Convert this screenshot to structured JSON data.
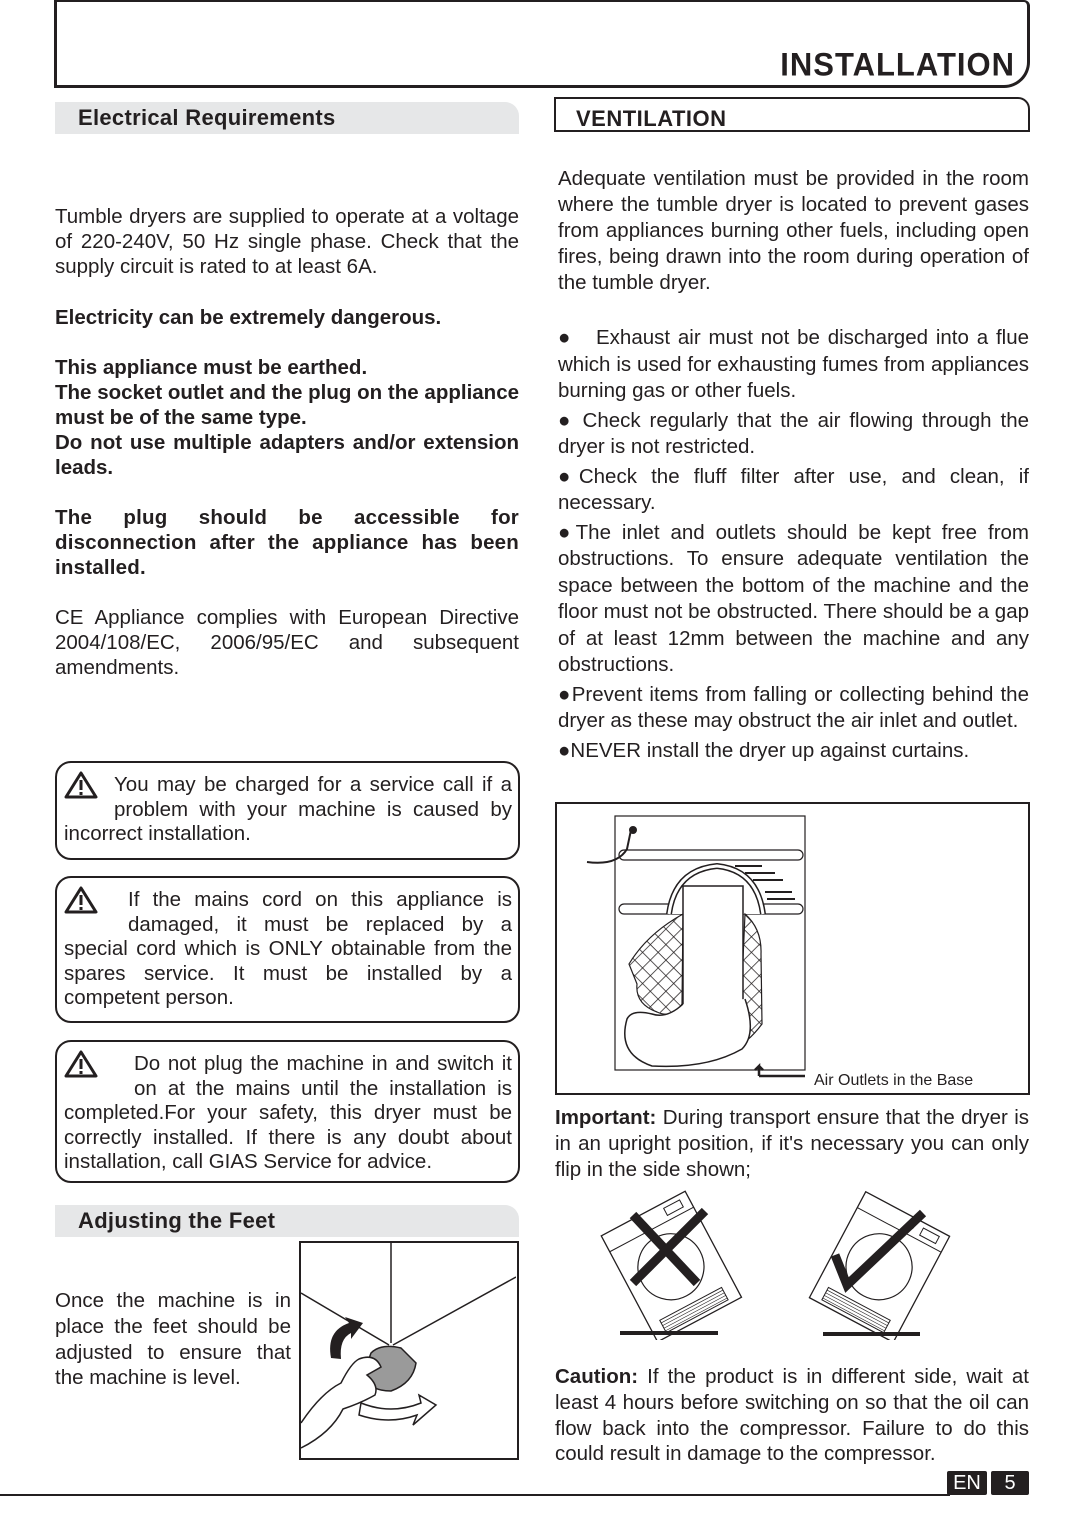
{
  "header": {
    "title": "INSTALLATION"
  },
  "left": {
    "electrical": {
      "heading": "Electrical Requirements",
      "para1": "Tumble dryers are supplied to operate at a voltage of 220-240V, 50 Hz single phase. Check that the supply circuit is rated to at least 6A.",
      "danger": "Electricity can be extremely dangerous.",
      "earthed": "This appliance must be earthed.",
      "socket": "The socket outlet and the plug on the appliance must be of the same type.",
      "adapters": "Do not use multiple adapters and/or extension leads.",
      "accessible": "The plug should be accessible for disconnection after the appliance has been installed.",
      "ce": "CE Appliance complies with European Directive 2004/108/EC, 2006/95/EC and subsequent amendments."
    },
    "warnings": [
      {
        "icon": "warning-triangle-icon",
        "text": "You may be charged for a service call if a problem with your machine is caused by incorrect installation."
      },
      {
        "icon": "warning-triangle-icon",
        "text": "If the mains cord on this appliance is damaged, it must be replaced by a special cord which is ONLY obtainable from the spares service. It must be installed by a competent person."
      },
      {
        "icon": "warning-triangle-icon",
        "text": "Do not plug the machine in and switch it on at the mains until the installation is completed.For your safety, this dryer must be correctly installed. If there is any doubt about installation, call GIAS Service for advice."
      }
    ],
    "feet": {
      "heading": "Adjusting the Feet",
      "text": "Once the machine is in place the feet should be adjusted to ensure that the machine is level."
    }
  },
  "right": {
    "ventilation": {
      "heading": "VENTILATION",
      "intro": "Adequate ventilation must be provided in the room where the tumble dryer is located to prevent gases from appliances burning other fuels, including open fires, being drawn into the room during operation of the tumble dryer.",
      "bullets": [
        "Exhaust air must not be discharged into a flue which is used for exhausting fumes from appliances burning gas or other fuels.",
        "Check regularly that the air flowing through the dryer is not restricted.",
        "Check the fluff filter after use, and clean, if necessary.",
        "The inlet and outlets should be kept free from obstructions. To ensure adequate ventilation the space between the bottom of the machine and the floor must not be obstructed. There should be a gap of at least 12mm between the machine and any obstructions.",
        "Prevent items from falling or collecting behind the dryer as these may obstruct the air inlet and outlet.",
        "NEVER install the dryer up against curtains."
      ],
      "figure_caption": "Air Outlets in the Base"
    },
    "important": {
      "label": "Important:",
      "text": " During transport ensure that the dryer is in an upright position, if it's necessary you can only flip in the side shown;"
    },
    "caution": {
      "label": "Caution:",
      "text": " If the product is in different side, wait at least 4 hours before switching on so that the oil can flow back into the compressor. Failure to do this could result in damage to the compressor."
    }
  },
  "footer": {
    "language": "EN",
    "page_number": "5"
  }
}
